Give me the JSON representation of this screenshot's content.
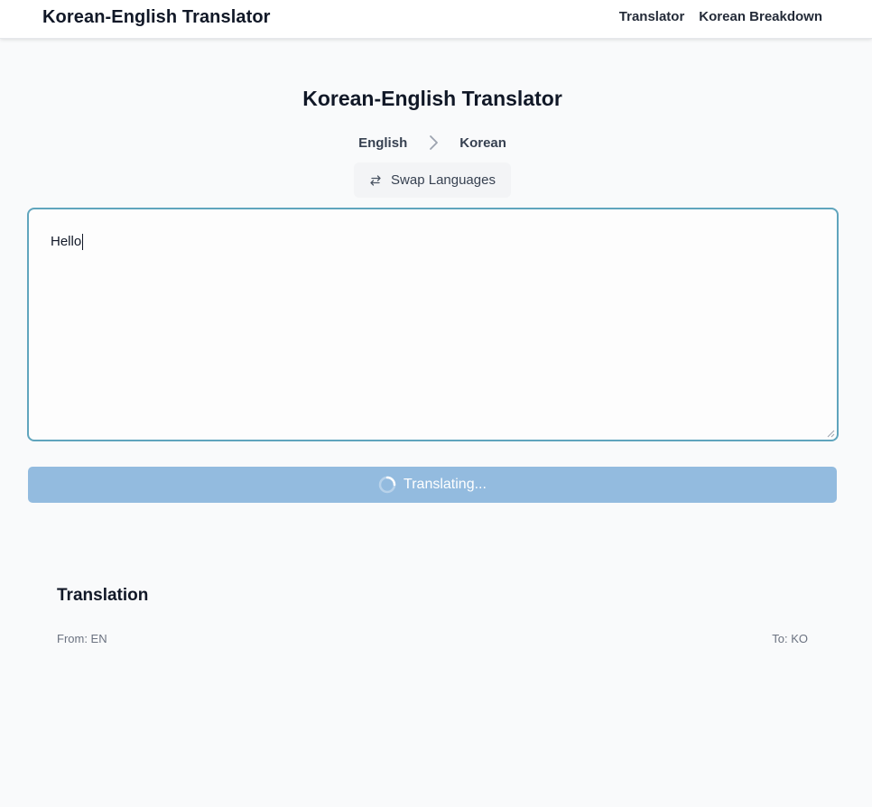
{
  "navbar": {
    "brand": "Korean-English Translator",
    "links": [
      "Translator",
      "Korean Breakdown"
    ]
  },
  "page": {
    "title": "Korean-English Translator"
  },
  "languages": {
    "source": "English",
    "target": "Korean",
    "swap_label": "Swap Languages"
  },
  "input": {
    "value": "Hello"
  },
  "translate_button": {
    "label": "Translating...",
    "state": "loading"
  },
  "result": {
    "title": "Translation",
    "from": "From: EN",
    "to": "To: KO"
  },
  "colors": {
    "input_border": "#60a5bd",
    "button_bg": "#93bbdf",
    "page_bg": "#f9fafb"
  },
  "icons": {
    "chevron": "chevron-right-icon",
    "swap": "swap-arrows-icon",
    "spinner": "spinner-icon"
  }
}
